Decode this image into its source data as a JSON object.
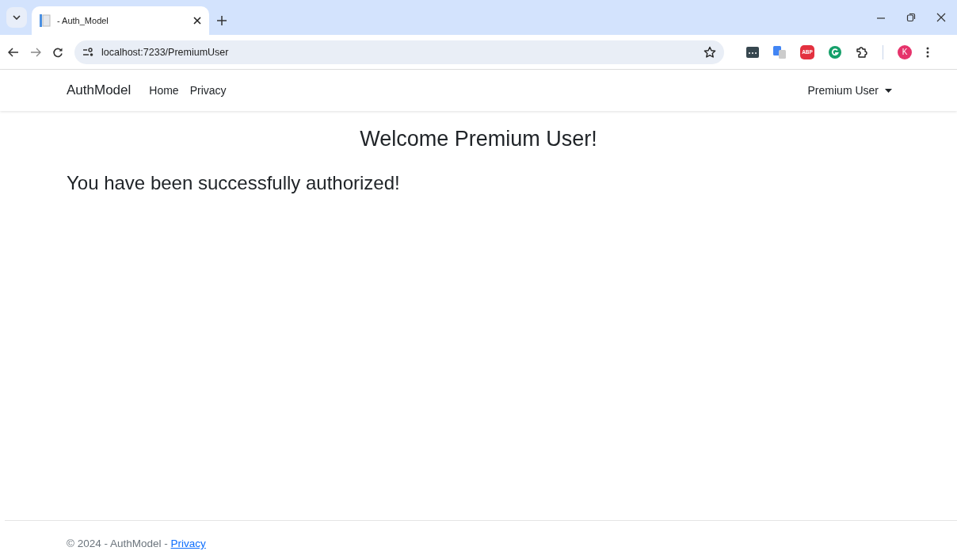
{
  "browser": {
    "tab": {
      "title": "- Auth_Model",
      "selected": true
    },
    "address": "localhost:7233/PremiumUser",
    "extension_badge": "ABP",
    "profile_initial": "K"
  },
  "navbar": {
    "brand": "AuthModel",
    "links": [
      {
        "label": "Home"
      },
      {
        "label": "Privacy"
      }
    ],
    "user_menu": "Premium User"
  },
  "main": {
    "heading": "Welcome Premium User!",
    "message": "You have been successfully authorized!"
  },
  "footer": {
    "text": "© 2024 - AuthModel - ",
    "link": "Privacy"
  }
}
